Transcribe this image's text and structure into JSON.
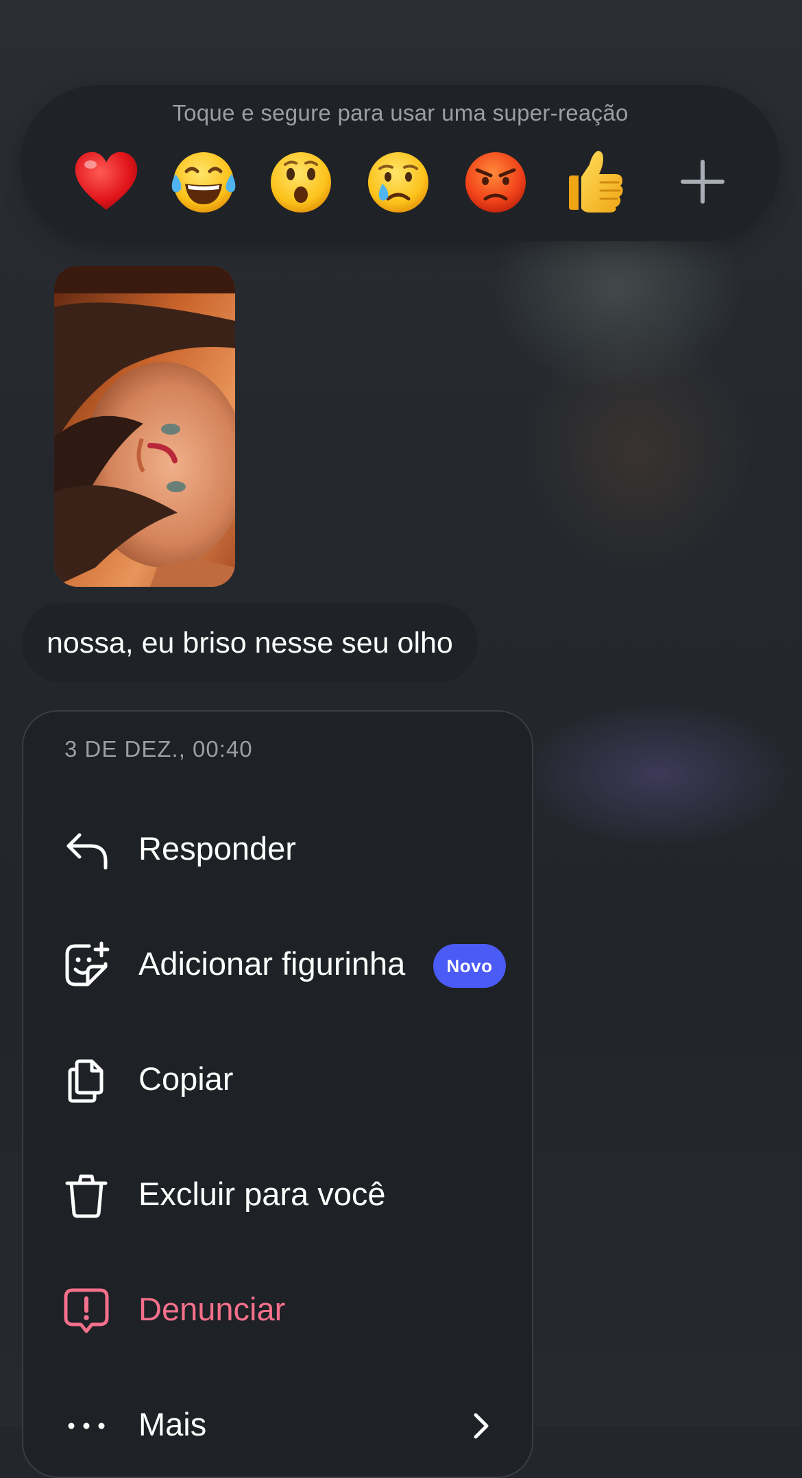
{
  "reactions": {
    "hint": "Toque e segure para usar uma super-reação",
    "emojis": [
      {
        "name": "heart-emoji",
        "glyph": "red-heart"
      },
      {
        "name": "tears-of-joy-emoji",
        "glyph": "face-with-tears-of-joy"
      },
      {
        "name": "surprised-emoji",
        "glyph": "face-with-open-mouth"
      },
      {
        "name": "crying-emoji",
        "glyph": "crying-face"
      },
      {
        "name": "angry-emoji",
        "glyph": "pouting-face"
      },
      {
        "name": "thumbs-up-emoji",
        "glyph": "thumbs-up"
      }
    ],
    "more_icon": "plus-icon"
  },
  "message": {
    "photo_icon": "selfie-photo",
    "text": "nossa, eu briso nesse seu olho"
  },
  "menu": {
    "timestamp": "3 DE DEZ., 00:40",
    "items": [
      {
        "label": "Responder",
        "icon": "reply-icon"
      },
      {
        "label": "Adicionar figurinha",
        "icon": "sticker-add-icon",
        "badge": "Novo"
      },
      {
        "label": "Copiar",
        "icon": "copy-icon"
      },
      {
        "label": "Excluir para você",
        "icon": "trash-icon"
      },
      {
        "label": "Denunciar",
        "icon": "report-icon"
      },
      {
        "label": "Mais",
        "icon": "more-icon"
      }
    ]
  },
  "colors": {
    "accent_badge": "#4a5bf6",
    "danger": "#f4708b",
    "menu_bg": "#1e2125"
  }
}
